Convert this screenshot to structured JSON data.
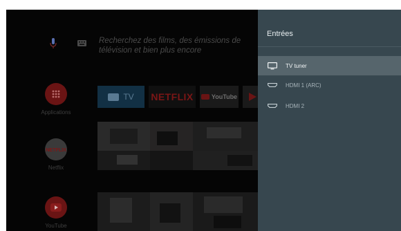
{
  "search": {
    "hint": "Recherchez des films, des émissions de télévision et bien plus encore"
  },
  "rail": [
    {
      "label": "Applications",
      "icon": "grid-icon"
    },
    {
      "label": "Netflix",
      "logo_text": "NETFLIX"
    },
    {
      "label": "YouTube",
      "icon": "youtube-play-icon"
    }
  ],
  "channels": {
    "tv_label": "TV",
    "netflix_label": "NETFLIX",
    "youtube_label": "YouTube"
  },
  "panel": {
    "title": "Entrées",
    "inputs": [
      {
        "label": "TV tuner",
        "icon": "tv-icon",
        "selected": true
      },
      {
        "label": "HDMI 1 (ARC)",
        "icon": "hdmi-icon",
        "selected": false
      },
      {
        "label": "HDMI 2",
        "icon": "hdmi-icon",
        "selected": false
      }
    ]
  },
  "colors": {
    "panel": "#37474f",
    "selected_row": "#56656c",
    "accent_red": "#6a1414"
  }
}
